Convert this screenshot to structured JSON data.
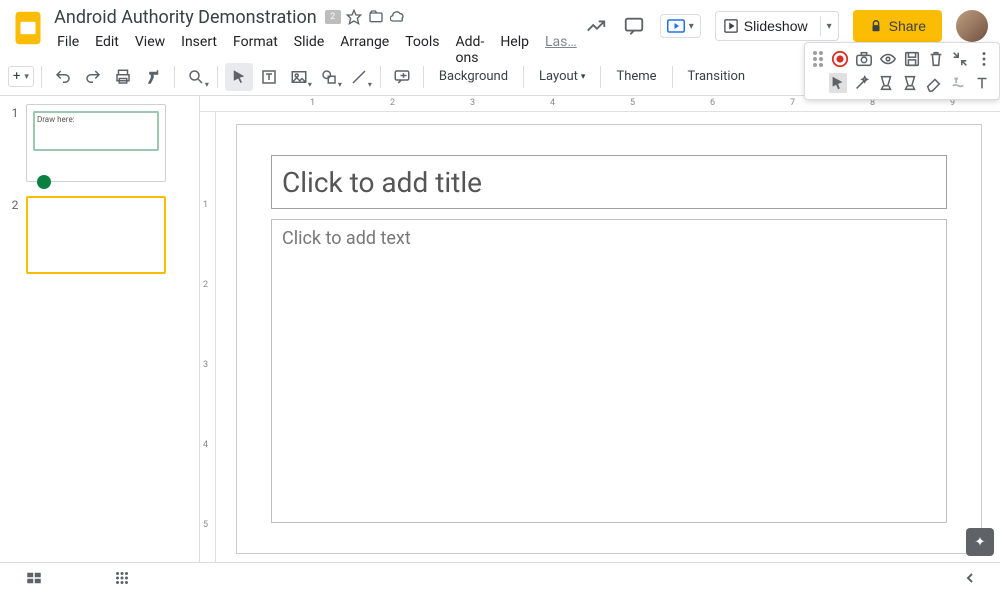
{
  "header": {
    "doc_title": "Android Authority Demonstration",
    "badge": "2",
    "menus": [
      "File",
      "Edit",
      "View",
      "Insert",
      "Format",
      "Slide",
      "Arrange",
      "Tools",
      "Add-ons",
      "Help"
    ],
    "last": "Las…",
    "slideshow": "Slideshow",
    "share": "Share"
  },
  "toolbar": {
    "new_slide_plus": "+",
    "background": "Background",
    "layout": "Layout",
    "theme": "Theme",
    "transition": "Transition"
  },
  "film": {
    "s1_num": "1",
    "s1_label": "Draw here:",
    "s2_num": "2"
  },
  "ruler_h": [
    "1",
    "2",
    "3",
    "4",
    "5",
    "6",
    "7",
    "8",
    "9"
  ],
  "ruler_v": [
    "1",
    "2",
    "3",
    "4",
    "5"
  ],
  "slide": {
    "title_placeholder": "Click to add title",
    "body_placeholder": "Click to add text"
  },
  "floating": {
    "icons_row1": [
      "record-icon",
      "camera-icon",
      "eye-icon",
      "save-icon",
      "trash-icon",
      "collapse-icon",
      "more-icon"
    ],
    "icons_row2": [
      "select-cursor-icon",
      "magic-wand-icon",
      "highlighter-1-icon",
      "highlighter-2-icon",
      "eraser-icon",
      "text-format-icon",
      "text-tool-icon"
    ]
  }
}
